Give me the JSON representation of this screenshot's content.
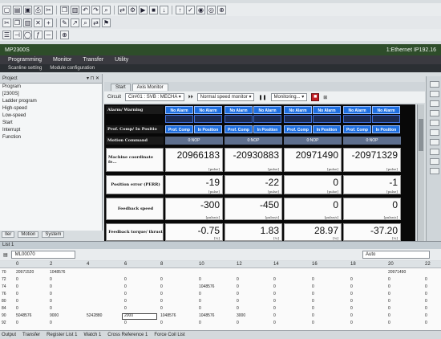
{
  "toolbar": {
    "row1_icons": [
      "new-icon",
      "open-icon",
      "save-icon",
      "print-icon",
      "cut-icon",
      "copy-icon",
      "paste-icon",
      "undo-icon",
      "redo-icon",
      "find-icon",
      "replace-icon",
      "compile-icon",
      "run-icon",
      "stop-icon",
      "write-icon",
      "read-icon",
      "verify-icon",
      "monitor-icon",
      "watch-icon",
      "zoom-icon"
    ],
    "row2_icons": [
      "cut-icon",
      "copy-icon",
      "paste-icon",
      "delete-icon",
      "insert-icon",
      "comment-icon",
      "jump-icon",
      "find-icon",
      "replace-icon",
      "bookmark-icon"
    ],
    "row3_icons": [
      "ladder-icon",
      "contact-icon",
      "coil-icon",
      "function-icon",
      "line-icon",
      "zoom-icon"
    ]
  },
  "titlebar": {
    "project": "MP2300S",
    "connection": "1:Ethernet IP192.16"
  },
  "menu": [
    "Programming",
    "Monitor",
    "Transfer",
    "Utility"
  ],
  "subtabs": [
    "Scanline setting",
    "Module configuration"
  ],
  "tree": {
    "header": "Project",
    "items": [
      "Program",
      "[2300S]",
      "Ladder program",
      "High-speed",
      "Low-speed",
      "Start",
      "Interrupt",
      "Function"
    ],
    "bottom_tabs": [
      "Iler",
      "Motion",
      "System"
    ]
  },
  "doc_tabs": [
    "Start",
    "Axis Monitor"
  ],
  "circuit_bar": {
    "label": "Circuit",
    "circuit_value": "Cir#01 : SVB : MECHA",
    "speed_mode": "Normal speed monitor",
    "monitor_state": "Monitoring..."
  },
  "monitor": {
    "rows": {
      "alarm": "Alarm/ Warning",
      "prof": "Prof. Comp/ In Positio",
      "motion": "Motion Command",
      "coord": "Machine coordinate fe...",
      "poserr": "Position error (PERR)",
      "fbspeed": "Feedback speed",
      "torque": "Feedback torque/ thrust"
    },
    "axes": [
      {
        "alarm_a": "No Alarm",
        "alarm_b": "No Alarm",
        "prof_a": "Prof. Comp",
        "prof_b": "In Position",
        "motion": "0:NOP",
        "coord": "20966183",
        "coord_unit": "[pulse]",
        "poserr": "-19",
        "poserr_unit": "[pulse]",
        "speed": "-300",
        "speed_unit": "[pulse/s]",
        "torque": "-0.75",
        "torque_unit": "[%]"
      },
      {
        "alarm_a": "No Alarm",
        "alarm_b": "No Alarm",
        "prof_a": "Prof. Comp",
        "prof_b": "In Position",
        "motion": "0:NOP",
        "coord": "-20930883",
        "coord_unit": "[pulse]",
        "poserr": "-22",
        "poserr_unit": "[pulse]",
        "speed": "-450",
        "speed_unit": "[pulse/s]",
        "torque": "1.83",
        "torque_unit": "[%]"
      },
      {
        "alarm_a": "No Alarm",
        "alarm_b": "No Alarm",
        "prof_a": "Prof. Comp",
        "prof_b": "In Position",
        "motion": "0:NOP",
        "coord": "20971490",
        "coord_unit": "[pulse]",
        "poserr": "0",
        "poserr_unit": "[pulse]",
        "speed": "0",
        "speed_unit": "[pulse/s]",
        "torque": "28.97",
        "torque_unit": "[%]"
      },
      {
        "alarm_a": "No Alarm",
        "alarm_b": "No Alarm",
        "prof_a": "Prof. Comp",
        "prof_b": "In Position",
        "motion": "0:NOP",
        "coord": "-20971329",
        "coord_unit": "[pulse]",
        "poserr": "-1",
        "poserr_unit": "[pulse]",
        "speed": "0",
        "speed_unit": "[pulse/s]",
        "torque": "-37.20",
        "torque_unit": "[%]"
      }
    ]
  },
  "list": {
    "title": "List 1",
    "device": "ML00070",
    "mode": "Auto",
    "columns": [
      "0",
      "2",
      "4",
      "6",
      "8",
      "10",
      "12",
      "14",
      "16",
      "18",
      "20",
      "22"
    ],
    "rows": [
      {
        "label": "70",
        "values": {
          "0": "20971520",
          "2": "1048576",
          "20": "20971490"
        }
      },
      {
        "label": "72",
        "values": {
          "0": "0",
          "2": "0",
          "6": "0",
          "8": "0",
          "10": "0",
          "12": "0",
          "14": "0",
          "16": "0",
          "18": "0",
          "20": "0",
          "22": "0"
        }
      },
      {
        "label": "74",
        "values": {
          "0": "0",
          "2": "0",
          "6": "0",
          "8": "0",
          "10": "1048576",
          "12": "0",
          "14": "0",
          "16": "0",
          "18": "0",
          "20": "0",
          "22": "0"
        }
      },
      {
        "label": "76",
        "values": {
          "0": "0",
          "2": "0",
          "6": "0",
          "8": "0",
          "10": "0",
          "12": "0",
          "14": "0",
          "16": "0",
          "18": "0",
          "20": "0",
          "22": "0"
        }
      },
      {
        "label": "80",
        "values": {
          "0": "0",
          "2": "0",
          "6": "0",
          "8": "0",
          "10": "0",
          "12": "0",
          "14": "0",
          "16": "0",
          "18": "0",
          "20": "0",
          "22": "0"
        }
      },
      {
        "label": "84",
        "values": {
          "0": "0",
          "2": "0",
          "6": "0",
          "8": "0",
          "10": "0",
          "12": "0",
          "14": "0",
          "16": "0",
          "18": "0",
          "20": "0",
          "22": "0"
        }
      },
      {
        "label": "90",
        "values": {
          "0": "5048576",
          "2": "9000",
          "4": "5242880",
          "6": "2000",
          "8": "1048576",
          "10": "1048576",
          "12": "3000",
          "14": "0",
          "16": "0",
          "18": "0",
          "20": "0",
          "22": "0"
        }
      },
      {
        "label": "92",
        "values": {
          "0": "0",
          "2": "0",
          "6": "0",
          "8": "0",
          "10": "0",
          "12": "0",
          "14": "0",
          "16": "0",
          "18": "0",
          "20": "0",
          "22": "0"
        }
      }
    ]
  },
  "status_tabs": [
    "Output",
    "Transfer",
    "Register List 1",
    "Watch 1",
    "Cross Reference 1",
    "Force Coil List"
  ]
}
